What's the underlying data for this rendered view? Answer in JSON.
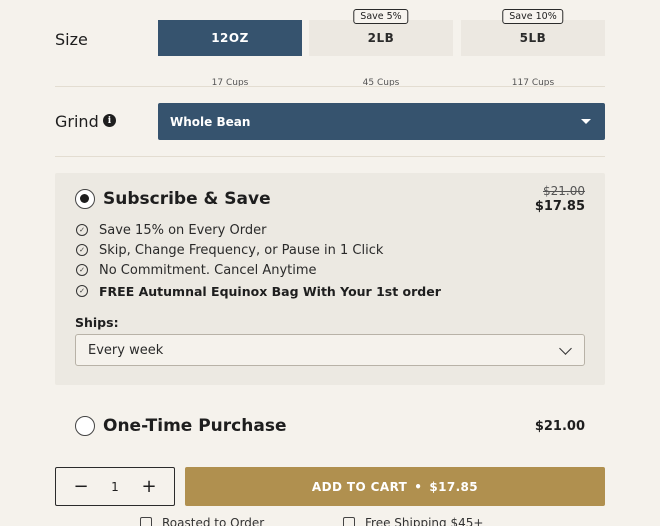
{
  "size": {
    "label": "Size",
    "options": [
      {
        "label": "12OZ",
        "sub": "17 Cups",
        "badge": ""
      },
      {
        "label": "2LB",
        "sub": "45 Cups",
        "badge": "Save 5%"
      },
      {
        "label": "5LB",
        "sub": "117 Cups",
        "badge": "Save 10%"
      }
    ],
    "selected": "12OZ"
  },
  "grind": {
    "label": "Grind",
    "info_icon": "info-icon",
    "selected": "Whole Bean"
  },
  "subscribe": {
    "title": "Subscribe & Save",
    "price_original": "$21.00",
    "price": "$17.85",
    "selected": true,
    "benefits": [
      "Save 15% on Every Order",
      "Skip, Change Frequency, or Pause in 1 Click",
      "No Commitment. Cancel Anytime",
      "FREE Autumnal Equinox Bag With Your 1st order"
    ],
    "ships_label": "Ships:",
    "ships_value": "Every week"
  },
  "one_time": {
    "title": "One-Time Purchase",
    "price": "$21.00",
    "selected": false
  },
  "cart": {
    "quantity": "1",
    "minus": "−",
    "plus": "+",
    "button_label": "ADD TO CART",
    "separator": "•",
    "button_price": "$17.85"
  },
  "footer": {
    "notes": [
      "Roasted to Order",
      "Free Shipping $45+"
    ]
  },
  "colors": {
    "background": "#f5f2ec",
    "selected_blue": "#36536e",
    "add_to_cart": "#b0904f"
  }
}
